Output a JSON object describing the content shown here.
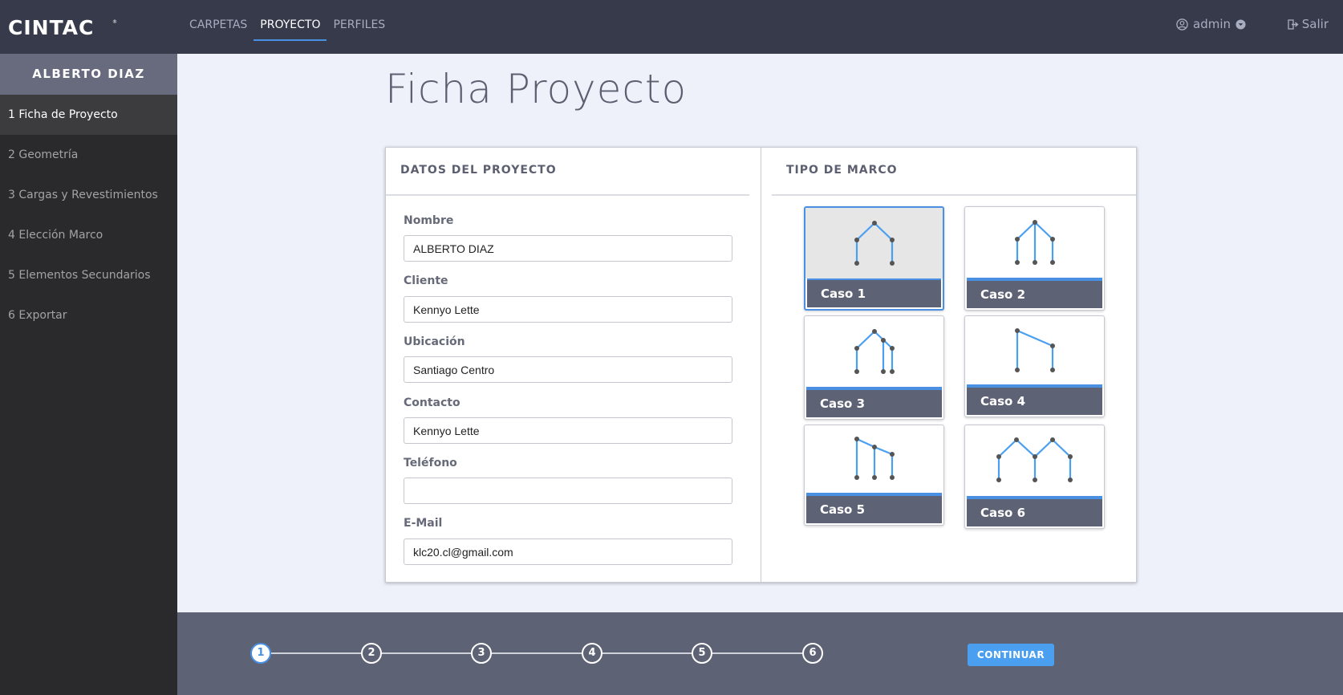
{
  "header": {
    "logo_text": "CINTAC",
    "logo_mark": "®",
    "nav": [
      {
        "label": "CARPETAS",
        "active": false
      },
      {
        "label": "PROYECTO",
        "active": true
      },
      {
        "label": "PERFILES",
        "active": false
      }
    ],
    "user_label": "admin",
    "user_icon": "user-circle-icon",
    "logout_label": "Salir",
    "logout_icon": "sign-out-icon"
  },
  "sidebar": {
    "title": "ALBERTO DIAZ",
    "items": [
      {
        "label": "1 Ficha de Proyecto",
        "active": true
      },
      {
        "label": "2 Geometría",
        "active": false
      },
      {
        "label": "3 Cargas y Revestimientos",
        "active": false
      },
      {
        "label": "4 Elección Marco",
        "active": false
      },
      {
        "label": "5 Elementos Secundarios",
        "active": false
      },
      {
        "label": "6 Exportar",
        "active": false
      }
    ]
  },
  "main": {
    "title": "Ficha Proyecto",
    "project_section": {
      "title": "DATOS DEL PROYECTO",
      "fields": [
        {
          "label": "Nombre",
          "value": "ALBERTO DIAZ",
          "placeholder": ""
        },
        {
          "label": "Cliente",
          "value": "Kennyo Lette",
          "placeholder": ""
        },
        {
          "label": "Ubicación",
          "value": "Santiago Centro",
          "placeholder": ""
        },
        {
          "label": "Contacto",
          "value": "Kennyo Lette",
          "placeholder": ""
        },
        {
          "label": "Teléfono",
          "value": "",
          "placeholder": ""
        },
        {
          "label": "E-Mail",
          "value": "klc20.cl@gmail.com",
          "placeholder": ""
        }
      ]
    },
    "frame_section": {
      "title": "TIPO DE MARCO",
      "selected": "Caso 1",
      "cases": [
        {
          "label": "Caso 1"
        },
        {
          "label": "Caso 2"
        },
        {
          "label": "Caso 3"
        },
        {
          "label": "Caso 4"
        },
        {
          "label": "Caso 5"
        },
        {
          "label": "Caso 6"
        }
      ]
    }
  },
  "footer": {
    "steps": [
      "1",
      "2",
      "3",
      "4",
      "5",
      "6"
    ],
    "current_step": "1",
    "continue_label": "CONTINUAR"
  },
  "colors": {
    "topbar": "#363a4a",
    "sidebar": "#2a2a2c",
    "accent": "#4a90e2",
    "footer": "#5e6275",
    "background": "#eef0fa"
  }
}
